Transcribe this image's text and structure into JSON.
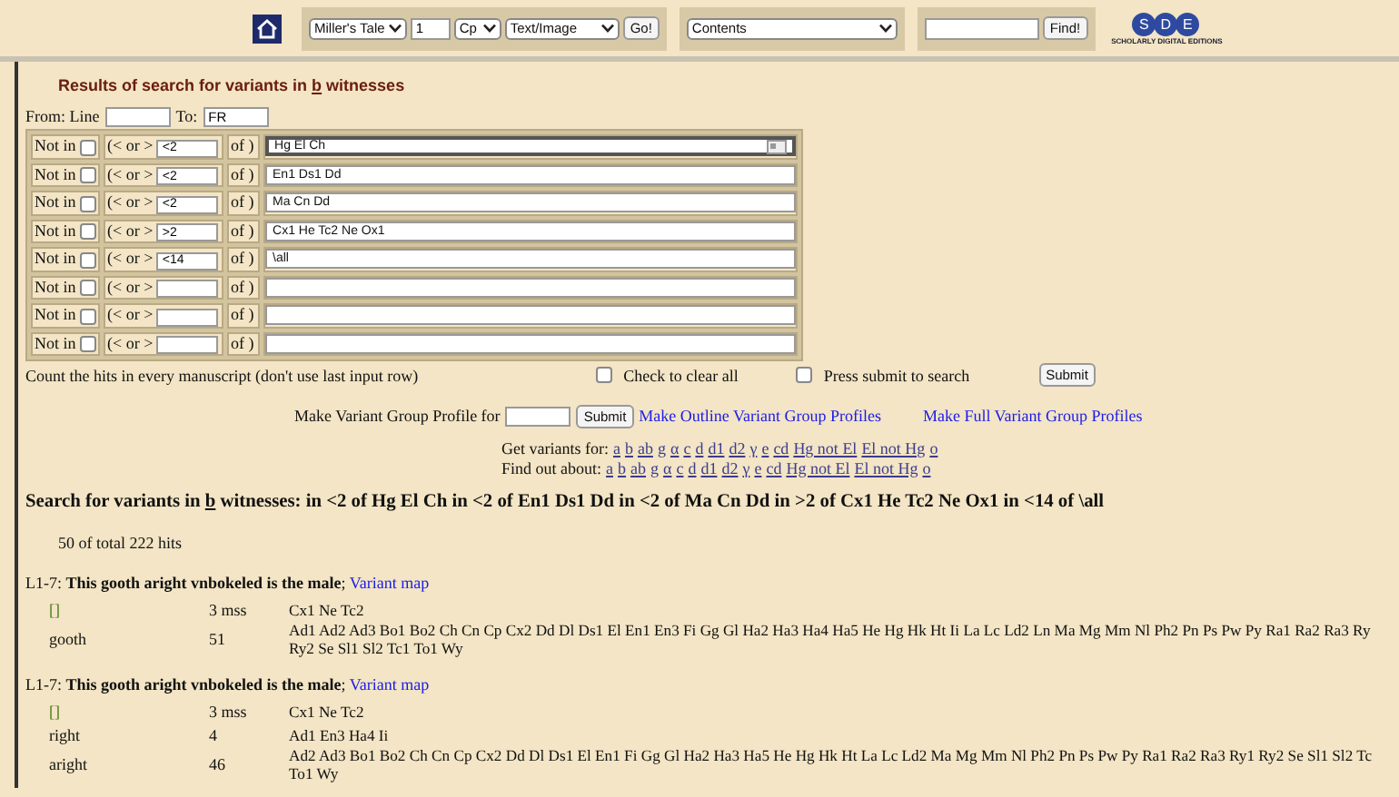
{
  "top_bar": {
    "tale": "Miller's Tale",
    "line": "1",
    "manuscript": "Cp",
    "view": "Text/Image",
    "go": "Go!",
    "contents": "Contents",
    "find": "Find!",
    "logo_letters": [
      "S",
      "D",
      "E"
    ],
    "logo_caption": "SCHOLARLY DIGITAL EDITIONS"
  },
  "title": {
    "before": "Results of search for variants in ",
    "letter": "b",
    "after": " witnesses"
  },
  "range": {
    "from_label": "From: Line",
    "to_label": "To:",
    "to": "FR"
  },
  "filters": [
    {
      "not_label": "Not in",
      "not_in": false,
      "op_label": "(< or >",
      "op": "<2",
      "of_label": "of )",
      "witnesses": "Hg El Ch",
      "focused": true
    },
    {
      "not_label": "Not in",
      "not_in": false,
      "op_label": "(< or >",
      "op": "<2",
      "of_label": "of )",
      "witnesses": "En1 Ds1 Dd",
      "focused": false
    },
    {
      "not_label": "Not in",
      "not_in": false,
      "op_label": "(< or >",
      "op": "<2",
      "of_label": "of )",
      "witnesses": "Ma Cn Dd",
      "focused": false
    },
    {
      "not_label": "Not in",
      "not_in": false,
      "op_label": "(< or >",
      "op": ">2",
      "of_label": "of )",
      "witnesses": "Cx1 He Tc2 Ne Ox1",
      "focused": false
    },
    {
      "not_label": "Not in",
      "not_in": false,
      "op_label": "(< or >",
      "op": "<14",
      "of_label": "of )",
      "witnesses": "\\all",
      "focused": false
    },
    {
      "not_label": "Not in",
      "not_in": false,
      "op_label": "(< or >",
      "of_label": "of )",
      "focused": false
    },
    {
      "not_label": "Not in",
      "not_in": false,
      "op_label": "(< or >",
      "of_label": "of )",
      "focused": false
    },
    {
      "not_label": "Not in",
      "not_in": false,
      "op_label": "(< or >",
      "of_label": "of )",
      "focused": false
    }
  ],
  "options": {
    "count_label": "Count the hits in every manuscript (don't use last input row)",
    "clear_label": "Check to clear all",
    "clear": false,
    "press_label": "Press submit to search",
    "press": false,
    "submit": "Submit"
  },
  "profile": {
    "label": "Make Variant Group Profile for",
    "submit": "Submit",
    "outline_link": "Make Outline Variant Group Profiles",
    "full_link": "Make Full Variant Group Profiles"
  },
  "get_variants": {
    "label": "Get variants for:",
    "links": [
      "a",
      "b",
      "ab",
      "g",
      "α",
      "c",
      "d",
      "d1",
      "d2",
      "γ",
      "e",
      "cd",
      "Hg not El",
      "El not Hg",
      "o"
    ]
  },
  "find_out": {
    "label": "Find out about:",
    "links": [
      "a",
      "b",
      "ab",
      "g",
      "α",
      "c",
      "d",
      "d1",
      "d2",
      "γ",
      "e",
      "cd",
      "Hg not El",
      "El not Hg",
      "o"
    ]
  },
  "search_heading": {
    "before": "Search for variants in ",
    "letter": "b",
    "after": " witnesses: in <2 of Hg El Ch in <2 of En1 Ds1 Dd in <2 of Ma Cn Dd in >2 of Cx1 He Tc2 Ne Ox1 in <14 of \\all"
  },
  "hits": "50 of total 222 hits",
  "results": [
    {
      "line": "L1-7:",
      "text": "This gooth aright vnbokeled is the male",
      "sep": ";",
      "link": "Variant map",
      "readings": [
        {
          "reading": "[]",
          "kind": "omission",
          "count": "3 mss",
          "witness_lines": [
            "Cx1 Ne Tc2"
          ]
        },
        {
          "reading": "gooth",
          "kind": "word",
          "count": "51",
          "witness_lines": [
            "Ad1 Ad2 Ad3 Bo1 Bo2 Ch Cn Cp Cx2 Dd Dl Ds1 El En1 En3 Fi Gg Gl Ha2 Ha3 Ha4 Ha5 He Hg Hk Ht Ii La Lc Ld2 Ln Ma Mg Mm Nl Ph2 Pn Ps Pw Py Ra1 Ra2 Ra3 Ry",
            "Ry2 Se Sl1 Sl2 Tc1 To1 Wy"
          ]
        }
      ]
    },
    {
      "line": "L1-7:",
      "text": "This gooth aright vnbokeled is the male",
      "sep": ";",
      "link": "Variant map",
      "readings": [
        {
          "reading": "[]",
          "kind": "omission",
          "count": "3 mss",
          "witness_lines": [
            "Cx1 Ne Tc2"
          ]
        },
        {
          "reading": "right",
          "kind": "word",
          "count": "4",
          "witness_lines": [
            "Ad1 En3 Ha4 Ii"
          ]
        },
        {
          "reading": "aright",
          "kind": "word",
          "count": "46",
          "witness_lines": [
            "Ad2 Ad3 Bo1 Bo2 Ch Cn Cp Cx2 Dd Dl Ds1 El En1 Fi Gg Gl Ha2 Ha3 Ha5 He Hg Hk Ht La Lc Ld2 Ma Mg Mm Nl Ph2 Pn Ps Pw Py Ra1 Ra2 Ra3 Ry1 Ry2 Se Sl1 Sl2 Tc",
            "To1 Wy"
          ]
        }
      ]
    }
  ]
}
